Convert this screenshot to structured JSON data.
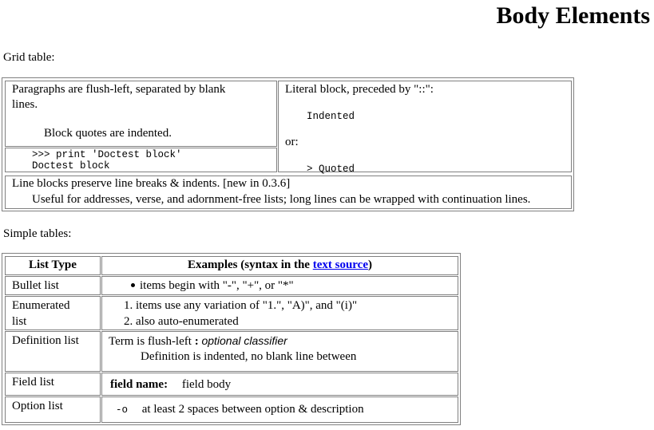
{
  "page": {
    "title": "Body Elements",
    "grid_label": "Grid table:",
    "simple_label": "Simple tables:"
  },
  "grid_table": {
    "paragraphs_line1": "Paragraphs are flush-left, separated by blank",
    "paragraphs_line2": "lines.",
    "block_quote": "Block quotes are indented.",
    "doctest_line1": ">>> print 'Doctest block'",
    "doctest_line2": "Doctest block",
    "literal_intro": "Literal block, preceded by \"::\":",
    "literal_indented": "Indented",
    "or_text": "or:",
    "literal_quoted": "> Quoted",
    "line_blocks": "Line blocks preserve line breaks & indents. [new in 0.3.6]",
    "line_blocks_detail": "Useful for addresses, verse, and adornment-free lists; long lines can be wrapped with continuation lines."
  },
  "simple_table": {
    "header_type": "List Type",
    "header_examples_prefix": "Examples (syntax in the ",
    "header_examples_link": "text source",
    "header_examples_suffix": ")",
    "rows": [
      {
        "type": "Bullet list",
        "example": "items begin with \"-\", \"+\", or \"*\""
      },
      {
        "type_line1": "Enumerated",
        "type_line2": "list",
        "marker1": "1.",
        "example1": "items use any variation of \"1.\", \"A)\", and \"(i)\"",
        "marker2": "2.",
        "example2": "also auto-enumerated"
      },
      {
        "type": "Definition list",
        "term": "Term is flush-left",
        "separator": ":",
        "classifier": "optional classifier",
        "definition": "Definition is indented, no blank line between"
      },
      {
        "type": "Field list",
        "field_name": "field name:",
        "field_body": "field body"
      },
      {
        "type": "Option list",
        "option": "-o",
        "description": "at least 2 spaces between option & description"
      }
    ]
  }
}
